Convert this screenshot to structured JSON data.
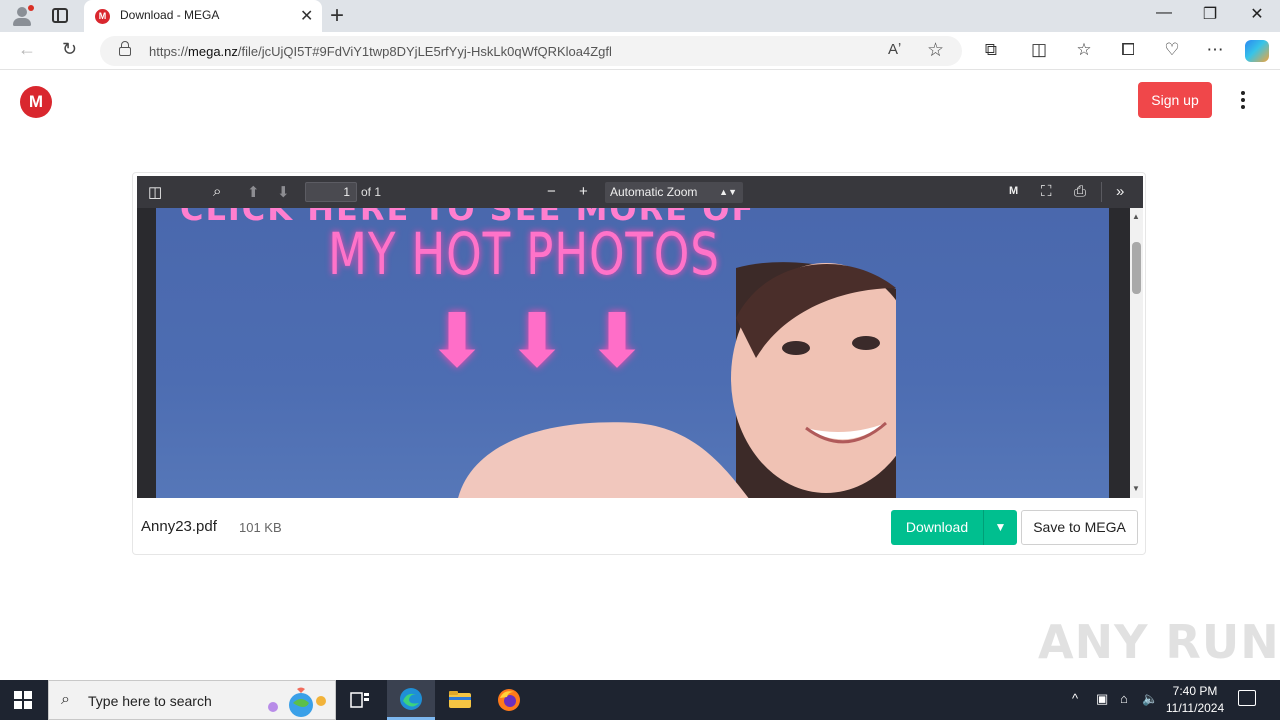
{
  "browser": {
    "tab_title": "Download - MEGA",
    "tab_favicon": "M",
    "url_prefix": "https://",
    "url_domain": "mega.nz",
    "url_rest": "/file/jcUjQI5T#9FdViY1twp8DYjLE5rfYyj-HskLk0qWfQRKloa4Zgfl",
    "icons": [
      "back-icon",
      "reload-icon",
      "lock-icon",
      "read-aloud-icon",
      "favorite-star-icon",
      "extensions-icon",
      "split-screen-icon",
      "favorites-icon",
      "collections-icon",
      "browser-essentials-icon",
      "more-icon",
      "copilot-icon"
    ]
  },
  "page": {
    "logo_letter": "M",
    "signup_label": "Sign up",
    "brand_color": "#d9272e",
    "signup_color": "#f0474a"
  },
  "pdf_viewer": {
    "page_number": "1",
    "page_count_label": "of 1",
    "zoom_label": "Automatic Zoom",
    "content_headline": "MY HOT PHOTOS",
    "content_cut_line": "CLICK HERE TO SEE MORE OF"
  },
  "file": {
    "name": "Anny23.pdf",
    "size": "101 KB",
    "download_label": "Download",
    "save_label": "Save to MEGA",
    "download_color": "#00bf8f"
  },
  "watermark": "ANY RUN",
  "taskbar": {
    "search_placeholder": "Type here to search",
    "time": "7:40 PM",
    "date": "11/11/2024"
  }
}
